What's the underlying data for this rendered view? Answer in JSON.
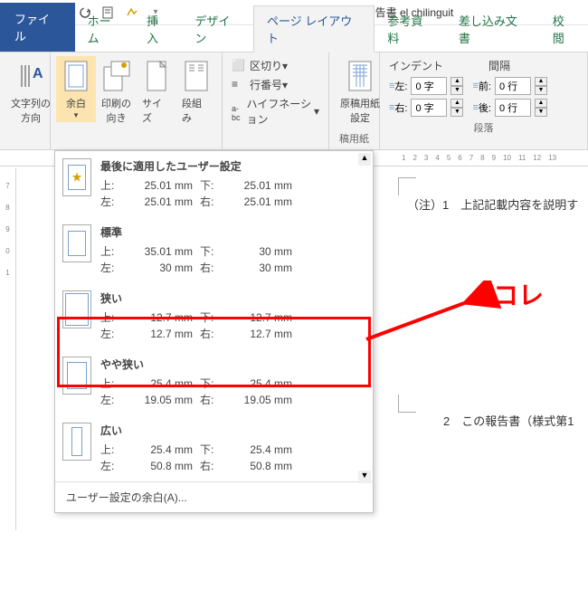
{
  "title": "事業実施概要報告書  el chilinguit",
  "tabs": {
    "file": "ファイル",
    "home": "ホーム",
    "insert": "挿入",
    "design": "デザイン",
    "layout": "ページ レイアウト",
    "references": "参考資料",
    "mailings": "差し込み文書",
    "review": "校閲"
  },
  "ribbon": {
    "textdir": "文字列の\n方向",
    "margin": "余白",
    "orient": "印刷の\n向き",
    "size": "サイズ",
    "columns": "段組み",
    "breaks": "区切り",
    "linenum": "行番号",
    "hyphen": "ハイフネーション",
    "manuscript": "原稿用紙\n設定",
    "manuscript_group": "稿用紙",
    "indent": "インデント",
    "spacing": "間隔",
    "left": "左:",
    "right": "右:",
    "before": "前:",
    "after": "後:",
    "left_val": "0 字",
    "right_val": "0 字",
    "before_val": "0 行",
    "after_val": "0 行",
    "paragraph": "段落"
  },
  "dropdown": {
    "presets": [
      {
        "name": "最後に適用したユーザー設定",
        "top": "25.01 mm",
        "bottom": "25.01 mm",
        "left": "25.01 mm",
        "right": "25.01 mm",
        "thumb": "star"
      },
      {
        "name": "標準",
        "top": "35.01 mm",
        "bottom": "30 mm",
        "left": "30 mm",
        "right": "30 mm",
        "thumb": "normal"
      },
      {
        "name": "狭い",
        "top": "12.7 mm",
        "bottom": "12.7 mm",
        "left": "12.7 mm",
        "right": "12.7 mm",
        "thumb": "narrow"
      },
      {
        "name": "やや狭い",
        "top": "25.4 mm",
        "bottom": "25.4 mm",
        "left": "19.05 mm",
        "right": "19.05 mm",
        "thumb": "moderate"
      },
      {
        "name": "広い",
        "top": "25.4 mm",
        "bottom": "25.4 mm",
        "left": "50.8 mm",
        "right": "50.8 mm",
        "thumb": "wide"
      }
    ],
    "labels": {
      "top": "上:",
      "bottom": "下:",
      "left": "左:",
      "right": "右:"
    },
    "custom": "ユーザー設定の余白(A)..."
  },
  "document": {
    "note": "（注）1　上記記載内容を説明す",
    "item2": "2　この報告書（様式第1"
  },
  "annotation": "コレ",
  "ruler_left": [
    "7",
    "8",
    "9",
    "0",
    "1"
  ]
}
